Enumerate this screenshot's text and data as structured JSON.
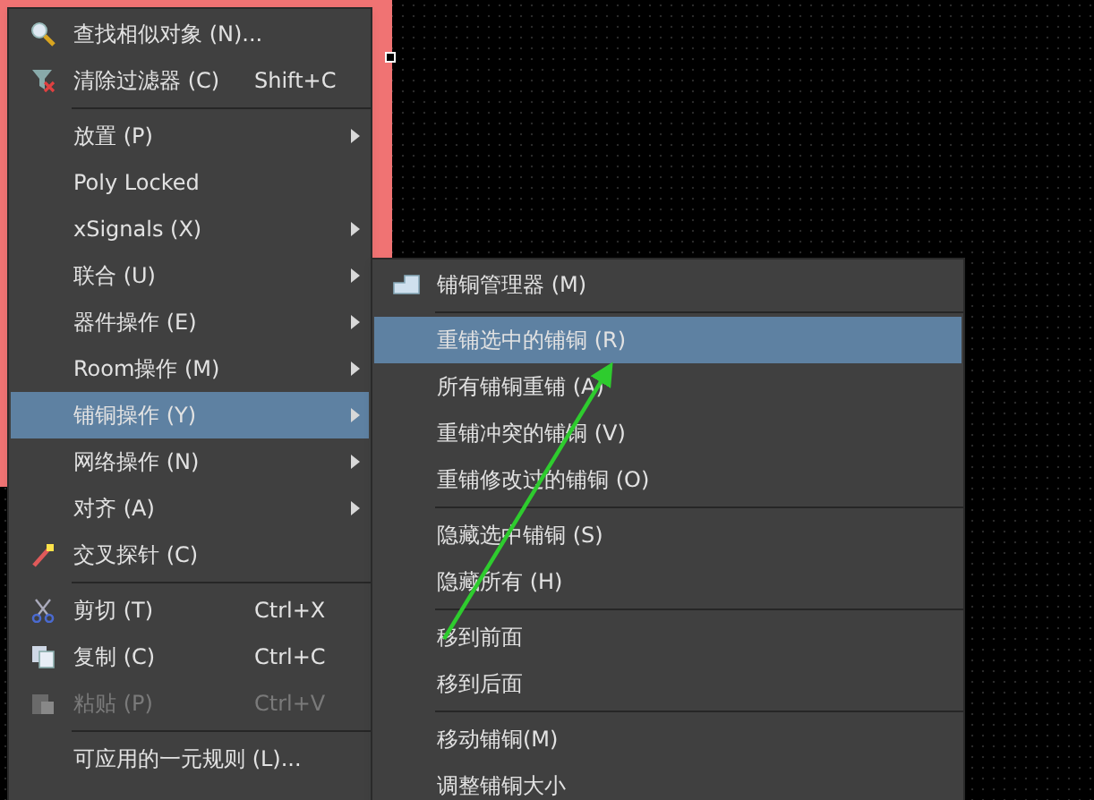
{
  "context_menu": {
    "items": [
      {
        "kind": "item",
        "label": "查找相似对象 (N)...",
        "selected": false,
        "disabled": false
      },
      {
        "kind": "item",
        "label": "清除过滤器 (C)",
        "shortcut": "Shift+C",
        "selected": false,
        "disabled": false
      },
      {
        "kind": "separator"
      },
      {
        "kind": "item",
        "label": "放置 (P)",
        "has_submenu": true,
        "selected": false,
        "disabled": false
      },
      {
        "kind": "item",
        "label": "Poly Locked",
        "selected": false,
        "disabled": false
      },
      {
        "kind": "item",
        "label": "xSignals (X)",
        "has_submenu": true,
        "selected": false,
        "disabled": false
      },
      {
        "kind": "item",
        "label": "联合 (U)",
        "has_submenu": true,
        "selected": false,
        "disabled": false
      },
      {
        "kind": "item",
        "label": "器件操作 (E)",
        "has_submenu": true,
        "selected": false,
        "disabled": false
      },
      {
        "kind": "item",
        "label": "Room操作 (M)",
        "has_submenu": true,
        "selected": false,
        "disabled": false
      },
      {
        "kind": "item",
        "label": "铺铜操作 (Y)",
        "has_submenu": true,
        "selected": true,
        "disabled": false
      },
      {
        "kind": "item",
        "label": "网络操作 (N)",
        "has_submenu": true,
        "selected": false,
        "disabled": false
      },
      {
        "kind": "item",
        "label": "对齐 (A)",
        "has_submenu": true,
        "selected": false,
        "disabled": false
      },
      {
        "kind": "item",
        "label": "交叉探针 (C)",
        "selected": false,
        "disabled": false
      },
      {
        "kind": "separator"
      },
      {
        "kind": "item",
        "label": "剪切 (T)",
        "shortcut": "Ctrl+X",
        "selected": false,
        "disabled": false
      },
      {
        "kind": "item",
        "label": "复制 (C)",
        "shortcut": "Ctrl+C",
        "selected": false,
        "disabled": false
      },
      {
        "kind": "item",
        "label": "粘贴 (P)",
        "shortcut": "Ctrl+V",
        "selected": false,
        "disabled": true
      },
      {
        "kind": "separator"
      },
      {
        "kind": "item",
        "label": "可应用的一元规则 (L)...",
        "selected": false,
        "disabled": false
      }
    ]
  },
  "submenu": {
    "items": [
      {
        "kind": "item",
        "label": "铺铜管理器 (M)",
        "selected": false
      },
      {
        "kind": "separator"
      },
      {
        "kind": "item",
        "label": "重铺选中的铺铜 (R)",
        "selected": true
      },
      {
        "kind": "item",
        "label": "所有铺铜重铺 (A)",
        "selected": false
      },
      {
        "kind": "item",
        "label": "重铺冲突的铺铜 (V)",
        "selected": false
      },
      {
        "kind": "item",
        "label": "重铺修改过的铺铜 (O)",
        "selected": false
      },
      {
        "kind": "separator"
      },
      {
        "kind": "item",
        "label": "隐藏选中铺铜 (S)",
        "selected": false
      },
      {
        "kind": "item",
        "label": "隐藏所有 (H)",
        "selected": false
      },
      {
        "kind": "separator"
      },
      {
        "kind": "item",
        "label": "移到前面",
        "selected": false
      },
      {
        "kind": "item",
        "label": "移到后面",
        "selected": false
      },
      {
        "kind": "separator"
      },
      {
        "kind": "item",
        "label": "移动铺铜(M)",
        "selected": false
      },
      {
        "kind": "item",
        "label": "调整铺铜大小",
        "selected": false
      }
    ]
  }
}
